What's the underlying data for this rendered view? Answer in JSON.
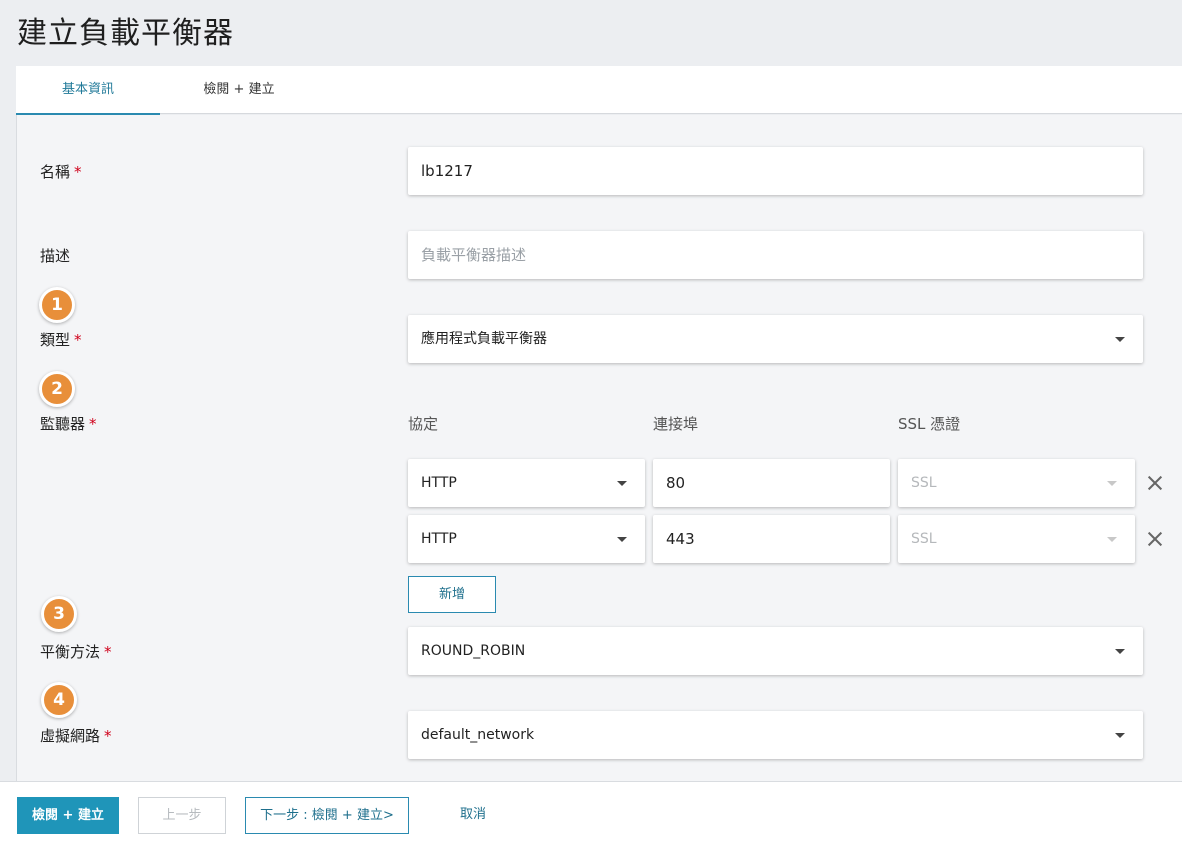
{
  "page": {
    "title": "建立負載平衡器"
  },
  "tabs": [
    {
      "label": "基本資訊",
      "active": true
    },
    {
      "label": "檢閱 + 建立",
      "active": false
    }
  ],
  "form": {
    "name": {
      "label": "名稱",
      "required_mark": "*",
      "value": "lb1217"
    },
    "description": {
      "label": "描述",
      "placeholder": "負載平衡器描述"
    },
    "type": {
      "label": "類型",
      "required_mark": "*",
      "value": "應用程式負載平衡器",
      "step": "1"
    },
    "listeners": {
      "label": "監聽器",
      "required_mark": "*",
      "step": "2",
      "headers": {
        "protocol": "協定",
        "port": "連接埠",
        "ssl": "SSL 憑證"
      },
      "rows": [
        {
          "protocol": "HTTP",
          "port": "80",
          "ssl": "SSL"
        },
        {
          "protocol": "HTTP",
          "port": "443",
          "ssl": "SSL"
        }
      ],
      "add_label": "新增"
    },
    "balancing": {
      "label": "平衡方法",
      "required_mark": "*",
      "value": "ROUND_ROBIN",
      "step": "3"
    },
    "network": {
      "label": "虛擬網路",
      "required_mark": "*",
      "value": "default_network",
      "step": "4"
    }
  },
  "footer": {
    "review_create": "檢閱 + 建立",
    "previous": "上一步",
    "next": "下一步 : 檢閱 + 建立>",
    "cancel": "取消"
  },
  "colors": {
    "accent": "#1f95b9",
    "step_badge": "#e88f3a",
    "required": "#d0021b"
  }
}
